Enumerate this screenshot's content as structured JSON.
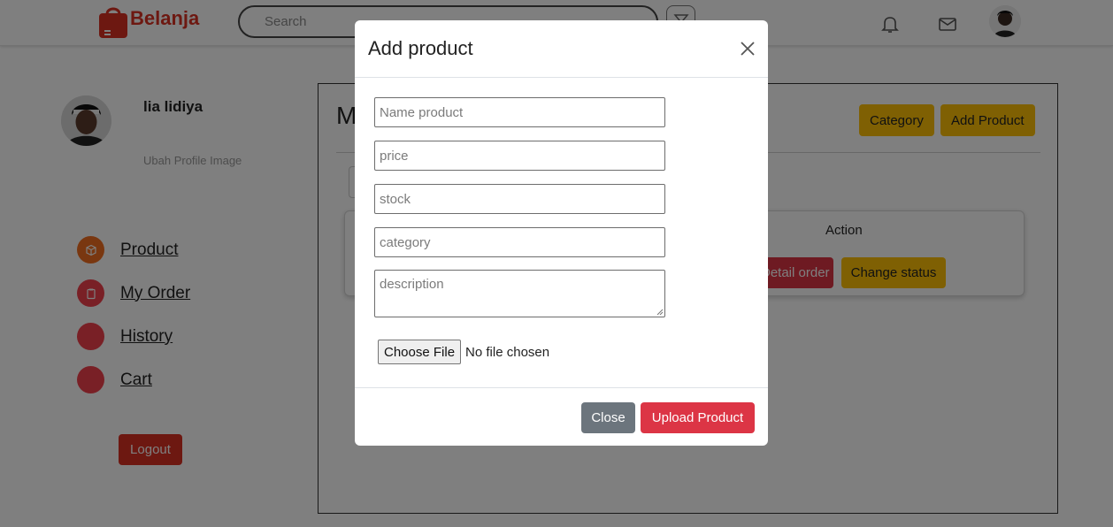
{
  "navbar": {
    "brand_name": "Belanja",
    "search_placeholder": "Search",
    "icons": [
      "bell-icon",
      "mail-icon",
      "filter-icon"
    ]
  },
  "profile": {
    "name": "lia lidiya",
    "change_image_label": "Ubah Profile Image"
  },
  "sidebar": {
    "items": [
      {
        "label": "Product",
        "color": "#f36f21"
      },
      {
        "label": "My Order",
        "color": "#f3414d"
      },
      {
        "label": "History",
        "color": "#f3414d"
      },
      {
        "label": "Cart",
        "color": "#f3414d"
      }
    ],
    "logout_label": "Logout"
  },
  "main": {
    "title_visible": "M",
    "category_label": "Category",
    "add_product_label": "Add Product",
    "table": {
      "action_header": "Action",
      "detail_order_label": "Detail order",
      "change_status_label": "Change status"
    }
  },
  "modal": {
    "title": "Add product",
    "fields": {
      "name_placeholder": "Name product",
      "price_placeholder": "price",
      "stock_placeholder": "stock",
      "category_placeholder": "category",
      "description_placeholder": "description"
    },
    "file": {
      "button_label": "Choose File",
      "status": "No file chosen"
    },
    "close_label": "Close",
    "upload_label": "Upload Product"
  },
  "colors": {
    "brand_red": "#db3022",
    "warning_yellow": "#ffc107",
    "danger_red": "#dc3545",
    "secondary_gray": "#6c757d"
  }
}
